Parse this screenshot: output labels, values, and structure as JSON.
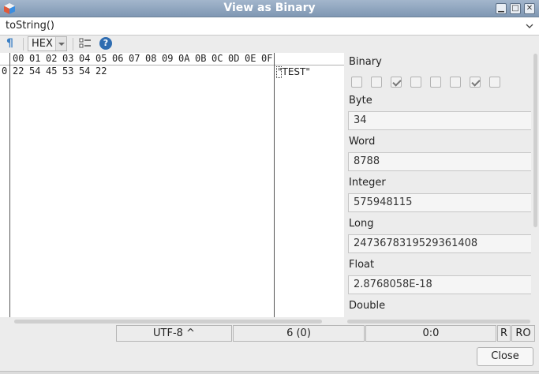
{
  "window": {
    "title": "View as Binary",
    "minimize_glyph": "▁",
    "maximize_glyph": "□",
    "close_glyph": "✕"
  },
  "expression_combo": {
    "value": "toString()"
  },
  "toolbar": {
    "pilcrow_icon": "¶",
    "mode_value": "HEX",
    "help_glyph": "?"
  },
  "hex_view": {
    "columns": [
      "00",
      "01",
      "02",
      "03",
      "04",
      "05",
      "06",
      "07",
      "08",
      "09",
      "0A",
      "0B",
      "0C",
      "0D",
      "0E",
      "0F"
    ],
    "rows": [
      {
        "offset": "0",
        "bytes": [
          "22",
          "54",
          "45",
          "53",
          "54",
          "22"
        ],
        "ascii": "\"TEST\""
      }
    ]
  },
  "values_panel": {
    "binary_label": "Binary",
    "binary_bits": [
      false,
      false,
      true,
      false,
      false,
      false,
      true,
      false
    ],
    "byte_label": "Byte",
    "byte_value": "34",
    "word_label": "Word",
    "word_value": "8788",
    "integer_label": "Integer",
    "integer_value": "575948115",
    "long_label": "Long",
    "long_value": "2473678319529361408",
    "float_label": "Float",
    "float_value": "2.8768058E-18",
    "double_label": "Double"
  },
  "status": {
    "encoding": "UTF-8 ^",
    "position": "6 (0)",
    "selection": "0:0",
    "r_mode": "R",
    "ro_mode": "RO"
  },
  "buttons": {
    "close_label": "Close"
  }
}
